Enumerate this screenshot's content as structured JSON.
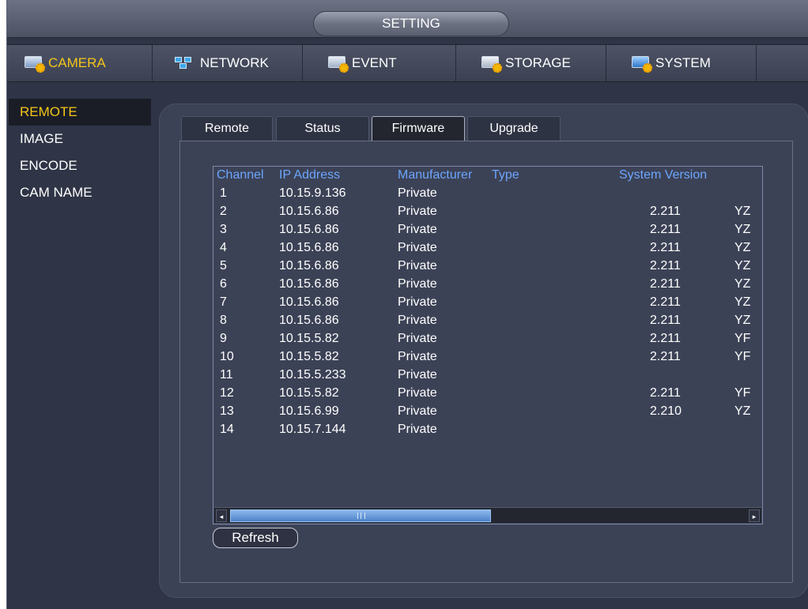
{
  "window": {
    "title": "SETTING"
  },
  "main_tabs": [
    {
      "label": "CAMERA",
      "icon": "camera-settings-icon",
      "active": true
    },
    {
      "label": "NETWORK",
      "icon": "network-icon",
      "active": false
    },
    {
      "label": "EVENT",
      "icon": "event-icon",
      "active": false
    },
    {
      "label": "STORAGE",
      "icon": "storage-icon",
      "active": false
    },
    {
      "label": "SYSTEM",
      "icon": "system-icon",
      "active": false
    }
  ],
  "side_menu": [
    {
      "label": "REMOTE",
      "active": true
    },
    {
      "label": "IMAGE",
      "active": false
    },
    {
      "label": "ENCODE",
      "active": false
    },
    {
      "label": "CAM NAME",
      "active": false
    }
  ],
  "sub_tabs": [
    {
      "label": "Remote",
      "active": false
    },
    {
      "label": "Status",
      "active": false
    },
    {
      "label": "Firmware",
      "active": true
    },
    {
      "label": "Upgrade",
      "active": false
    }
  ],
  "table": {
    "columns": [
      "Channel",
      "IP Address",
      "Manufacturer",
      "Type",
      "System Version"
    ],
    "rows": [
      {
        "channel": "1",
        "ip": "10.15.9.136",
        "manufacturer": "Private",
        "type": "",
        "version": "",
        "extra": ""
      },
      {
        "channel": "2",
        "ip": "10.15.6.86",
        "manufacturer": "Private",
        "type": "",
        "version": "2.211",
        "extra": "YZ"
      },
      {
        "channel": "3",
        "ip": "10.15.6.86",
        "manufacturer": "Private",
        "type": "",
        "version": "2.211",
        "extra": "YZ"
      },
      {
        "channel": "4",
        "ip": "10.15.6.86",
        "manufacturer": "Private",
        "type": "",
        "version": "2.211",
        "extra": "YZ"
      },
      {
        "channel": "5",
        "ip": "10.15.6.86",
        "manufacturer": "Private",
        "type": "",
        "version": "2.211",
        "extra": "YZ"
      },
      {
        "channel": "6",
        "ip": "10.15.6.86",
        "manufacturer": "Private",
        "type": "",
        "version": "2.211",
        "extra": "YZ"
      },
      {
        "channel": "7",
        "ip": "10.15.6.86",
        "manufacturer": "Private",
        "type": "",
        "version": "2.211",
        "extra": "YZ"
      },
      {
        "channel": "8",
        "ip": "10.15.6.86",
        "manufacturer": "Private",
        "type": "",
        "version": "2.211",
        "extra": "YZ"
      },
      {
        "channel": "9",
        "ip": "10.15.5.82",
        "manufacturer": "Private",
        "type": "",
        "version": "2.211",
        "extra": "YF"
      },
      {
        "channel": "10",
        "ip": "10.15.5.82",
        "manufacturer": "Private",
        "type": "",
        "version": "2.211",
        "extra": "YF"
      },
      {
        "channel": "11",
        "ip": "10.15.5.233",
        "manufacturer": "Private",
        "type": "",
        "version": "",
        "extra": ""
      },
      {
        "channel": "12",
        "ip": "10.15.5.82",
        "manufacturer": "Private",
        "type": "",
        "version": "2.211",
        "extra": "YF"
      },
      {
        "channel": "13",
        "ip": "10.15.6.99",
        "manufacturer": "Private",
        "type": "",
        "version": "2.210",
        "extra": "YZ"
      },
      {
        "channel": "14",
        "ip": "10.15.7.144",
        "manufacturer": "Private",
        "type": "",
        "version": "",
        "extra": ""
      }
    ]
  },
  "scrollbar": {
    "left_arrow": "◂",
    "right_arrow": "▸"
  },
  "buttons": {
    "refresh": "Refresh"
  },
  "colors": {
    "accent_active": "#f5c518",
    "header_text": "#6ca6ff",
    "background": "#2f3546"
  }
}
